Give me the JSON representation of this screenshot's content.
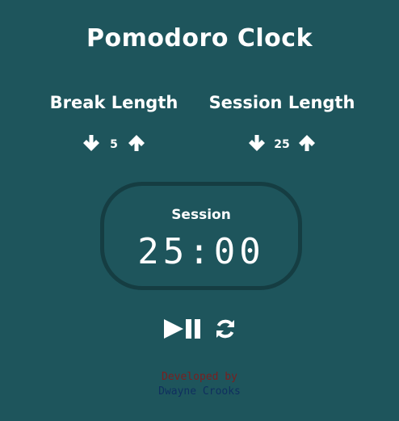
{
  "app": {
    "title": "Pomodoro Clock"
  },
  "break": {
    "label": "Break Length",
    "value": "5",
    "decrement_icon": "arrow-down-icon",
    "increment_icon": "arrow-up-icon"
  },
  "session": {
    "label": "Session Length",
    "value": "25",
    "decrement_icon": "arrow-down-icon",
    "increment_icon": "arrow-up-icon"
  },
  "timer": {
    "label": "Session",
    "time": "25:00"
  },
  "controls": {
    "play_pause_icon": "play-pause-icon",
    "reset_icon": "refresh-icon"
  },
  "footer": {
    "line1": "Developed by",
    "line2": "Dwayne Crooks"
  },
  "colors": {
    "background": "#1e555c",
    "timer_border": "#153d42",
    "text": "#ffffff",
    "credit_line1": "#7a1f1f",
    "credit_line2": "#0f2f5f"
  }
}
